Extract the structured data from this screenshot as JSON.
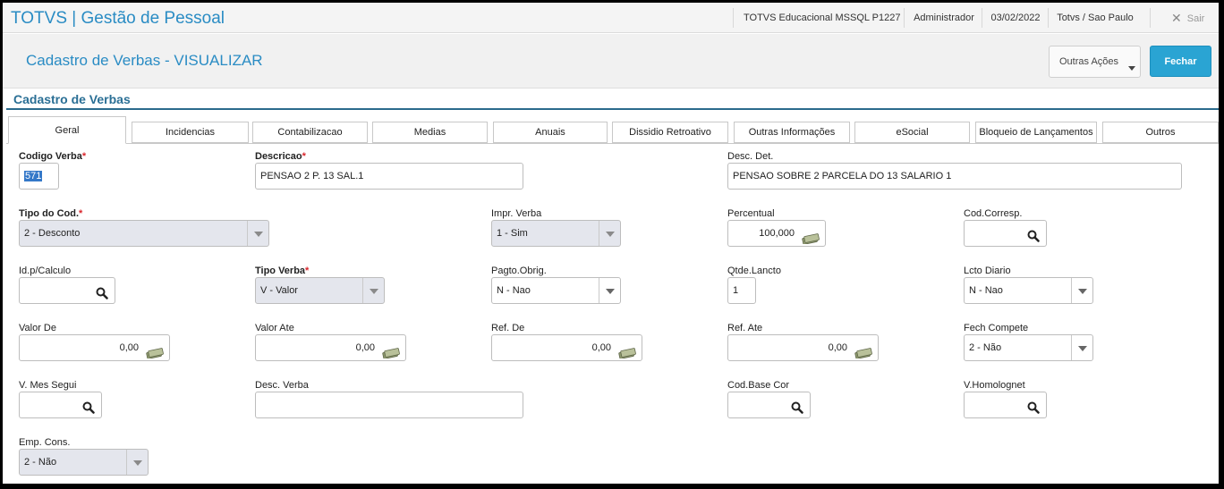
{
  "topbar": {
    "app_title": "TOTVS | Gestão de Pessoal",
    "environment": "TOTVS Educacional MSSQL P1227",
    "user": "Administrador",
    "date": "03/02/2022",
    "branch": "Totvs / Sao Paulo",
    "logout_label": "Sair"
  },
  "header": {
    "page_title": "Cadastro de Verbas - VISUALIZAR",
    "outras_acoes_label": "Outras Ações",
    "fechar_label": "Fechar"
  },
  "section_title": "Cadastro de Verbas",
  "tabs": [
    "Geral",
    "Incidencias",
    "Contabilizacao",
    "Medias",
    "Anuais",
    "Dissidio Retroativo",
    "Outras Informações",
    "eSocial",
    "Bloqueio de Lançamentos",
    "Outros"
  ],
  "active_tab": "Geral",
  "required_mark": "*",
  "fields": {
    "codigo_verba": {
      "label": "Codigo Verba",
      "value": "571"
    },
    "descricao": {
      "label": "Descricao",
      "value": "PENSAO 2 P. 13 SAL.1"
    },
    "desc_det": {
      "label": "Desc. Det.",
      "value": "PENSAO SOBRE 2 PARCELA DO 13 SALARIO 1"
    },
    "tipo_do_cod": {
      "label": "Tipo do Cod.",
      "value": "2 - Desconto"
    },
    "impr_verba": {
      "label": "Impr. Verba",
      "value": "1 - Sim"
    },
    "percentual": {
      "label": "Percentual",
      "value": "100,000"
    },
    "cod_corresp": {
      "label": "Cod.Corresp.",
      "value": ""
    },
    "id_calculo": {
      "label": "Id.p/Calculo",
      "value": ""
    },
    "tipo_verba": {
      "label": "Tipo Verba",
      "value": "V - Valor"
    },
    "pagto_obrig": {
      "label": "Pagto.Obrig.",
      "value": "N - Nao"
    },
    "qtde_lancto": {
      "label": "Qtde.Lancto",
      "value": "1"
    },
    "lcto_diario": {
      "label": "Lcto Diario",
      "value": "N - Nao"
    },
    "valor_de": {
      "label": "Valor De",
      "value": "0,00"
    },
    "valor_ate": {
      "label": "Valor Ate",
      "value": "0,00"
    },
    "ref_de": {
      "label": "Ref. De",
      "value": "0,00"
    },
    "ref_ate": {
      "label": "Ref. Ate",
      "value": "0,00"
    },
    "fech_compete": {
      "label": "Fech Compete",
      "value": "2 - Não"
    },
    "v_mes_segui": {
      "label": "V. Mes Segui",
      "value": ""
    },
    "desc_verba": {
      "label": "Desc. Verba",
      "value": ""
    },
    "cod_base_cor": {
      "label": "Cod.Base Cor",
      "value": ""
    },
    "v_homolognet": {
      "label": "V.Homolognet",
      "value": ""
    },
    "emp_cons": {
      "label": "Emp. Cons.",
      "value": "2 - Não"
    }
  },
  "icons": {
    "search": "search-icon",
    "money": "money-icon",
    "dropdown": "chevron-down-icon",
    "close": "close-icon"
  },
  "colors": {
    "brand": "#2a8cc4",
    "button": "#2aa4d3",
    "required": "#d9262c",
    "section": "#2a6f95"
  }
}
